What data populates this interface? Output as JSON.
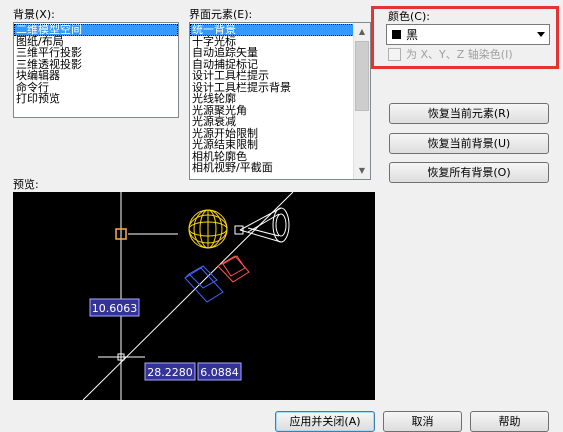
{
  "background": {
    "label": "背景(X):",
    "items": [
      {
        "label": "二维模型空间",
        "selected": true
      },
      {
        "label": "图纸/布局",
        "selected": false
      },
      {
        "label": "三维平行投影",
        "selected": false
      },
      {
        "label": "三维透视投影",
        "selected": false
      },
      {
        "label": "块编辑器",
        "selected": false
      },
      {
        "label": "命令行",
        "selected": false
      },
      {
        "label": "打印预览",
        "selected": false
      }
    ]
  },
  "elements": {
    "label": "界面元素(E):",
    "items": [
      {
        "label": "统一背景",
        "selected": true
      },
      {
        "label": "十字光标",
        "selected": false
      },
      {
        "label": "自动追踪矢量",
        "selected": false
      },
      {
        "label": "自动捕捉标记",
        "selected": false
      },
      {
        "label": "设计工具栏提示",
        "selected": false
      },
      {
        "label": "设计工具栏提示背景",
        "selected": false
      },
      {
        "label": "光线轮廓",
        "selected": false
      },
      {
        "label": "光源聚光角",
        "selected": false
      },
      {
        "label": "光源衰减",
        "selected": false
      },
      {
        "label": "光源开始限制",
        "selected": false
      },
      {
        "label": "光源结束限制",
        "selected": false
      },
      {
        "label": "相机轮廓色",
        "selected": false
      },
      {
        "label": "相机视野/平截面",
        "selected": false
      }
    ]
  },
  "color": {
    "label": "颜色(C):",
    "value": "黑",
    "swatch": "#000000",
    "tint_label": "为 X、Y、Z 轴染色(I)",
    "tint_checked": false
  },
  "buttons": {
    "restore_element": "恢复当前元素(R)",
    "restore_background": "恢复当前背景(U)",
    "restore_all": "恢复所有背景(O)",
    "apply_close": "应用并关闭(A)",
    "cancel": "取消",
    "help": "帮助"
  },
  "preview": {
    "label": "预览:",
    "value_a": "10.6063",
    "value_b": "28.2280",
    "value_c": "6.0884"
  },
  "colors": {
    "highlight": "#e53333",
    "selection": "#3399ff",
    "preview_bg": "#000000",
    "dim_box": "#333399",
    "light_yellow": "#ffd700",
    "crosshair": "#ffffff"
  }
}
